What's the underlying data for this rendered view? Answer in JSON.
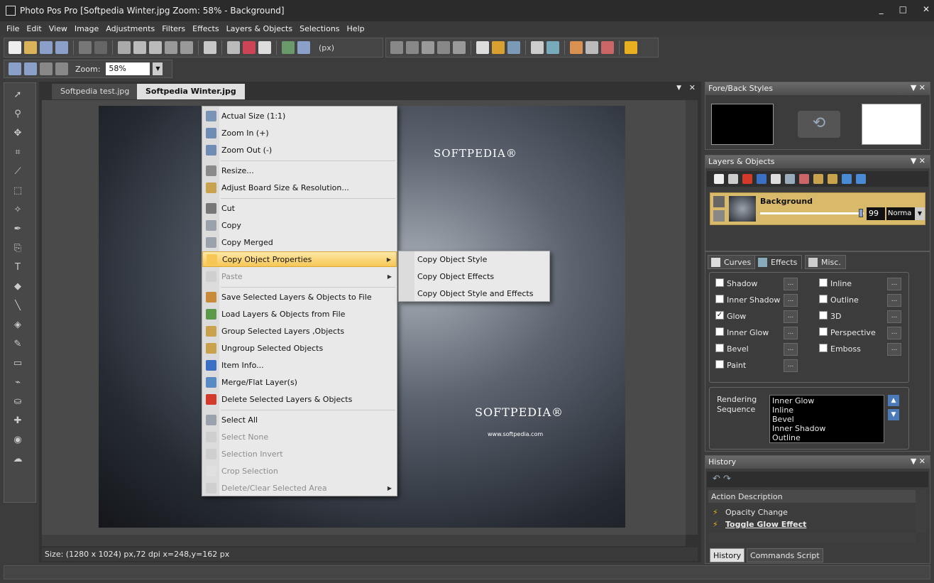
{
  "window": {
    "title": "Photo Pos Pro [Softpedia Winter.jpg Zoom: 58% - Background]",
    "min": "_",
    "max": "□",
    "close": "✕"
  },
  "menu": [
    "File",
    "Edit",
    "View",
    "Image",
    "Adjustments",
    "Filters",
    "Effects",
    "Layers & Objects",
    "Selections",
    "Help"
  ],
  "toolbar": {
    "units": "(px)",
    "zoom_label": "Zoom:",
    "zoom_value": "58%"
  },
  "tabs": [
    "Softpedia test.jpg",
    "Softpedia Winter.jpg"
  ],
  "status": {
    "text": "Size: (1280 x 1024) px,72 dpi   x=248,y=162 px"
  },
  "photo": {
    "brand1": "SOFTPEDIA®",
    "brand2": "SOFTPEDIA®",
    "url": "www.softpedia.com"
  },
  "context_menu": [
    {
      "label": "Actual Size (1:1)",
      "icon": "actual-size-icon",
      "color": "#7a94b8"
    },
    {
      "label": "Zoom In (+)",
      "icon": "zoom-in-icon",
      "color": "#6f8cb5"
    },
    {
      "label": "Zoom Out (-)",
      "icon": "zoom-out-icon",
      "color": "#6f8cb5"
    },
    {
      "label": "Resize...",
      "icon": "resize-icon",
      "color": "#8a8a8a"
    },
    {
      "label": "Adjust Board  Size & Resolution...",
      "icon": "board-icon",
      "color": "#c9a24d"
    },
    {
      "label": "Cut",
      "icon": "scissors-icon",
      "color": "#777777"
    },
    {
      "label": "Copy",
      "icon": "copy-icon",
      "color": "#9aa3ad"
    },
    {
      "label": "Copy Merged",
      "icon": "copy-merged-icon",
      "color": "#9aa3ad"
    },
    {
      "label": "Copy Object Properties",
      "icon": "copy-props-icon",
      "color": "#f7c756"
    },
    {
      "label": "Paste",
      "icon": "paste-icon",
      "color": "#cfcfcf"
    },
    {
      "label": "Save Selected Layers & Objects to File",
      "icon": "save-layers-icon",
      "color": "#c98a3a"
    },
    {
      "label": "Load Layers & Objects from File",
      "icon": "load-layers-icon",
      "color": "#5a9a4a"
    },
    {
      "label": "Group Selected Layers ,Objects",
      "icon": "group-icon",
      "color": "#c9a24d"
    },
    {
      "label": "Ungroup Selected Objects",
      "icon": "ungroup-icon",
      "color": "#c9a24d"
    },
    {
      "label": "Item Info...",
      "icon": "info-icon",
      "color": "#3a6fc4"
    },
    {
      "label": "Merge/Flat Layer(s)",
      "icon": "merge-icon",
      "color": "#5a8ac4"
    },
    {
      "label": "Delete Selected Layers & Objects",
      "icon": "delete-icon",
      "color": "#d43a2a"
    },
    {
      "label": "Select All",
      "icon": "select-all-icon",
      "color": "#9aa3ad"
    },
    {
      "label": "Select None",
      "icon": "select-none-icon",
      "color": "#cfcfcf"
    },
    {
      "label": "Selection Invert",
      "icon": "invert-icon",
      "color": "#cfcfcf"
    },
    {
      "label": "Crop Selection",
      "icon": "crop-icon",
      "color": "#e0e0e0"
    },
    {
      "label": "Delete/Clear Selected Area",
      "icon": "clear-icon",
      "color": "#cfcfcf"
    }
  ],
  "submenu": [
    "Copy Object Style",
    "Copy Object Effects",
    "Copy Object Style and Effects"
  ],
  "fore_back": {
    "title": "Fore/Back Styles",
    "fore": "#000000",
    "back": "#ffffff"
  },
  "layers": {
    "title": "Layers & Objects",
    "layer_name": "Background",
    "opacity": "99",
    "blend": "Norma",
    "opacity_fraction": 0.97
  },
  "effects_tabs": [
    "Curves",
    "Effects",
    "Misc."
  ],
  "effects": {
    "left": [
      {
        "label": "Shadow",
        "checked": false
      },
      {
        "label": "Inner Shadow",
        "checked": false
      },
      {
        "label": "Glow",
        "checked": true
      },
      {
        "label": "Inner Glow",
        "checked": false
      },
      {
        "label": "Bevel",
        "checked": false
      },
      {
        "label": "Paint",
        "checked": false
      }
    ],
    "right": [
      {
        "label": "Inline",
        "checked": false
      },
      {
        "label": "Outline",
        "checked": false
      },
      {
        "label": "3D",
        "checked": false
      },
      {
        "label": "Perspective",
        "checked": false
      },
      {
        "label": "Emboss",
        "checked": false
      }
    ],
    "more": "...",
    "rendering_label": "Rendering Sequence",
    "sequence": [
      "Inner Glow",
      "Inline",
      "Bevel",
      "Inner Shadow",
      "Outline"
    ]
  },
  "history": {
    "title": "History",
    "header": "Action Description",
    "items": [
      "Opacity Change",
      "Toggle Glow Effect"
    ],
    "tabs": [
      "History",
      "Commands Script"
    ]
  }
}
